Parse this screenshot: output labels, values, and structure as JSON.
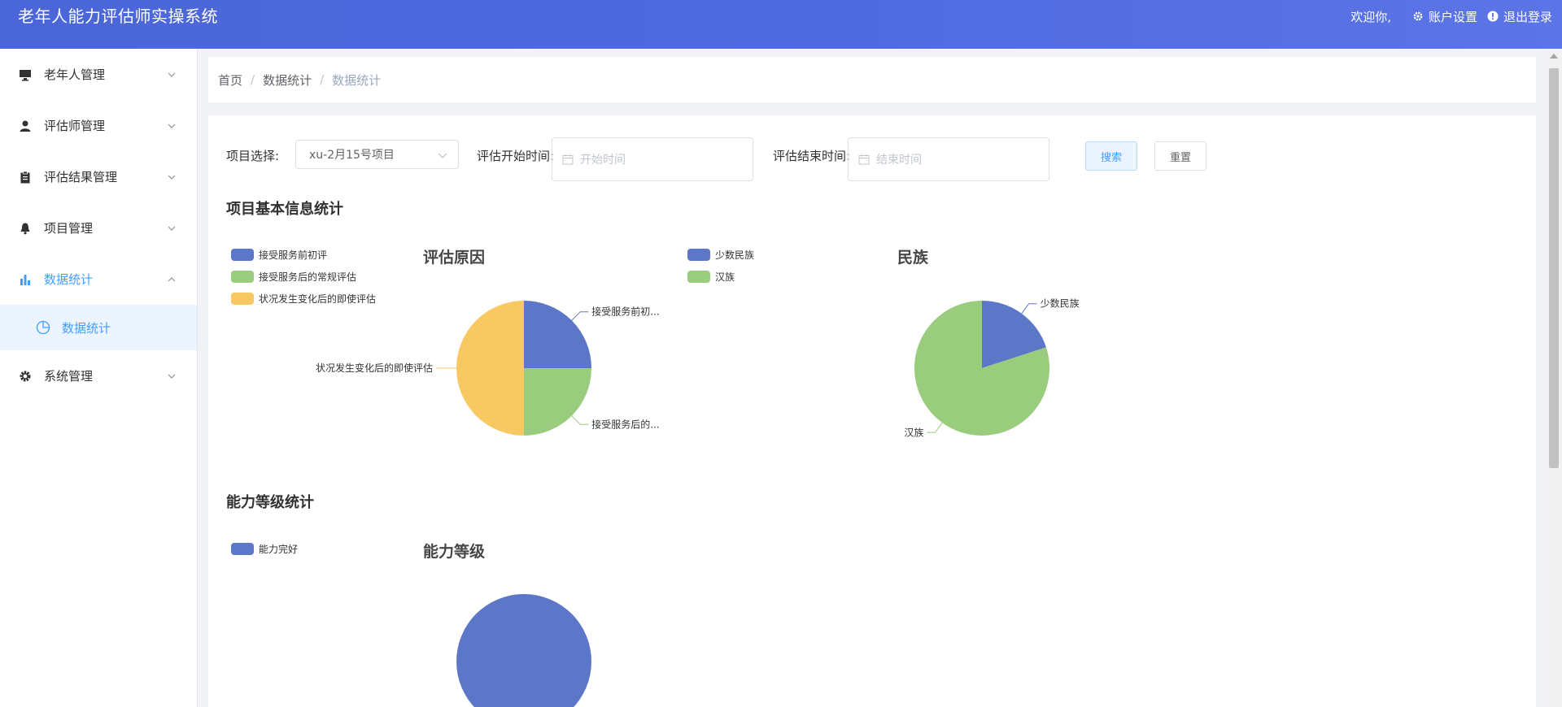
{
  "header": {
    "title": "老年人能力评估师实操系统",
    "welcome": "欢迎你,",
    "account_settings": "账户设置",
    "logout": "退出登录",
    "account_icon": "gear-icon",
    "logout_icon": "alert-circle-icon"
  },
  "sidebar": {
    "items": [
      {
        "label": "老年人管理",
        "icon": "monitor-icon"
      },
      {
        "label": "评估师管理",
        "icon": "user-icon"
      },
      {
        "label": "评估结果管理",
        "icon": "clipboard-icon"
      },
      {
        "label": "项目管理",
        "icon": "bell-icon"
      },
      {
        "label": "数据统计",
        "icon": "bar-chart-icon",
        "expanded": true
      },
      {
        "label": "系统管理",
        "icon": "gear-icon"
      }
    ],
    "sub_item": {
      "label": "数据统计",
      "icon": "pie-chart-icon"
    }
  },
  "breadcrumb": [
    "首页",
    "数据统计",
    "数据统计"
  ],
  "filters": {
    "project_label": "项目选择:",
    "project_value": "xu-2月15号项目",
    "start_label": "评估开始时间:",
    "start_placeholder": "开始时间",
    "end_label": "评估结束时间:",
    "end_placeholder": "结束时间",
    "search_button": "搜索",
    "reset_button": "重置"
  },
  "sections": {
    "basic_info": "项目基本信息统计",
    "ability": "能力等级统计"
  },
  "colors": {
    "blue": "#5d77c8",
    "green": "#99cd7d",
    "yellow": "#f8c862",
    "accent": "#409eff"
  },
  "chart_data": [
    {
      "type": "pie",
      "title": "评估原因",
      "legend": [
        "接受服务前初评",
        "接受服务后的常规评估",
        "状况发生变化后的即使评估"
      ],
      "slices": [
        {
          "label": "接受服务前初评",
          "display_label": "接受服务前初...",
          "value": 1,
          "color": "#5d77c8"
        },
        {
          "label": "接受服务后的常规评估",
          "display_label": "接受服务后的...",
          "value": 1,
          "color": "#99cd7d"
        },
        {
          "label": "状况发生变化后的即使评估",
          "display_label": "状况发生变化后的即使评估",
          "value": 2,
          "color": "#f8c862"
        }
      ],
      "legend_position": "top-left"
    },
    {
      "type": "pie",
      "title": "民族",
      "legend": [
        "少数民族",
        "汉族"
      ],
      "slices": [
        {
          "label": "少数民族",
          "display_label": "少数民族",
          "value": 1,
          "color": "#5d77c8"
        },
        {
          "label": "汉族",
          "display_label": "汉族",
          "value": 4,
          "color": "#99cd7d"
        }
      ],
      "legend_position": "top-left"
    },
    {
      "type": "pie",
      "title": "能力等级",
      "legend": [
        "能力完好"
      ],
      "slices": [
        {
          "label": "能力完好",
          "display_label": "",
          "value": 1,
          "color": "#5d77c8"
        }
      ],
      "legend_position": "top-left"
    }
  ]
}
